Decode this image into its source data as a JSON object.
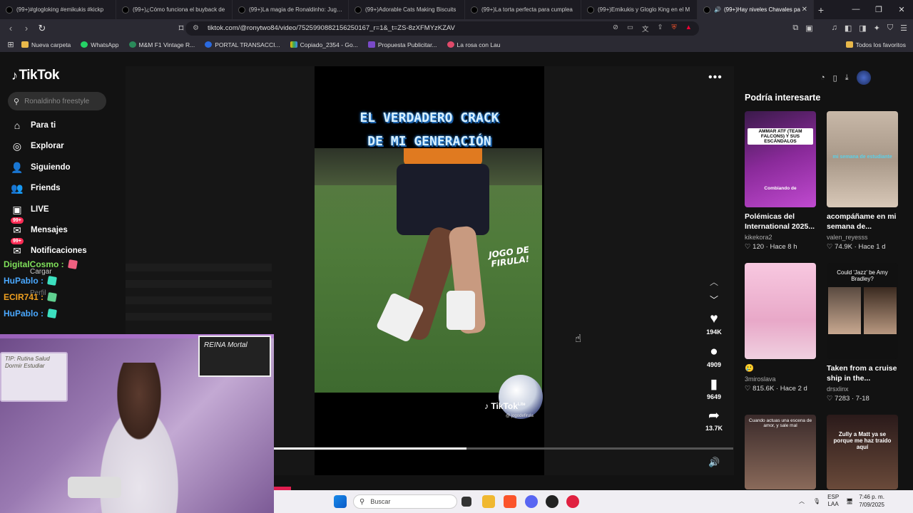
{
  "browser": {
    "tabs": [
      {
        "title": "(99+)#glogloking #emikukis #kickp"
      },
      {
        "title": "(99+)¿Cómo funciona el buyback de"
      },
      {
        "title": "(99+)La magia de Ronaldinho: Jugad"
      },
      {
        "title": "(99+)Adorable Cats Making Biscuits"
      },
      {
        "title": "(99+)La torta perfecta para cumplea"
      },
      {
        "title": "(99+)Emikukis y Gloglo King en el M"
      },
      {
        "title": "(99+)Hay niveles Chavales pa"
      }
    ],
    "url": "tiktok.com/@ronytwo84/video/7525990882156250167_r=1&_t=ZS-8zXFMYzKZAV",
    "bookmarks": [
      "Nueva carpeta",
      "WhatsApp",
      "M&M F1 Vintage R...",
      "PORTAL TRANSACCI...",
      "Copiado_2354 - Go...",
      "Propuesta Publicitar...",
      "La rosa con Lau"
    ],
    "bookmarks_right": "Todos los favoritos"
  },
  "tiktok": {
    "logo": "TikTok",
    "search_placeholder": "Ronaldinho freestyle",
    "nav": [
      {
        "label": "Para ti",
        "icon": "home-icon"
      },
      {
        "label": "Explorar",
        "icon": "compass-icon"
      },
      {
        "label": "Siguiendo",
        "icon": "following-icon"
      },
      {
        "label": "Friends",
        "icon": "friends-icon"
      },
      {
        "label": "LIVE",
        "icon": "live-icon"
      },
      {
        "label": "Mensajes",
        "icon": "messages-icon",
        "badge": "99+"
      },
      {
        "label": "Notificaciones",
        "icon": "notifications-icon",
        "badge": "99+"
      }
    ],
    "menu_partial": [
      "Cargar",
      "Perfil"
    ],
    "video": {
      "caption_line1": "EL VERDADERO CRACK",
      "caption_line2": "DE MI GENERACIÓN",
      "overlay": "JOGO DE FIRULA!",
      "watermark": "TikTok",
      "watermark_sup": "Lite",
      "watermark_user": "@ jogodefirula",
      "progress": 0.42
    },
    "actions": [
      {
        "name": "like",
        "icon": "heart-icon",
        "count": "194K"
      },
      {
        "name": "comment",
        "icon": "comment-icon",
        "count": "4909"
      },
      {
        "name": "save",
        "icon": "bookmark-icon",
        "count": "9649"
      },
      {
        "name": "share",
        "icon": "share-icon",
        "count": "13.7K"
      }
    ],
    "suggestions_title": "Podría interesarte",
    "suggestions": [
      {
        "title": "Polémicas del International 2025...",
        "author": "kikekora2",
        "likes": "120",
        "time": "Hace 8 h",
        "cap1": "AMMAR ATF (TEAM FALCONS) Y SUS ESCÁNDALOS",
        "cap2": "Combiando de"
      },
      {
        "title": "acompáñame en mi semana de...",
        "author": "valen_reyesss",
        "likes": "74.9K",
        "time": "Hace 1 d",
        "cap1": "mi semana de estudiante"
      },
      {
        "title": "🥲",
        "author": "3miroslava",
        "likes": "815.6K",
        "time": "Hace 2 d"
      },
      {
        "title": "Taken from a cruise ship in the...",
        "author": "drsxlinx",
        "likes": "7283",
        "time": "7-18",
        "cap1": "Could 'Jazz' be Amy Bradley?"
      },
      {
        "cap1": "Cuando actuas una escena de amor, y sale mal"
      },
      {
        "cap1": "Zully a Matt ya se porque me haz traido aquí"
      }
    ]
  },
  "chat": [
    {
      "user": "DigitalCosmo",
      "color": "#7fe05a"
    },
    {
      "user": "HuPablo",
      "color": "#4aa8ff"
    },
    {
      "user": "ECIR741",
      "color": "#f0a020"
    },
    {
      "user": "HuPablo",
      "color": "#4aa8ff"
    }
  ],
  "webcam": {
    "board_text": "TIP: Rutina Salud Dormir Estudiar",
    "frame_text": "REINA Mortal"
  },
  "taskbar": {
    "search": "Buscar",
    "lang1": "ESP",
    "lang2": "LAA",
    "time": "7:46 p. m.",
    "date": "7/09/2025"
  }
}
